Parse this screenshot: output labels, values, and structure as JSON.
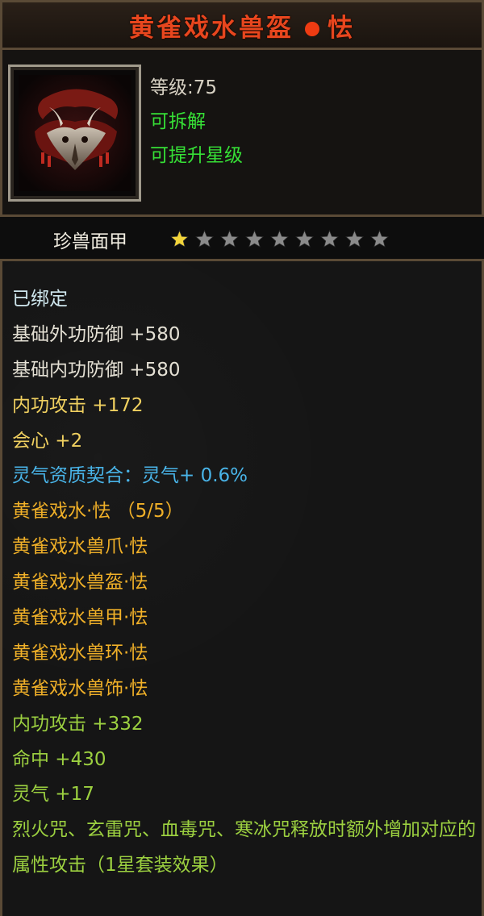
{
  "title": {
    "name_left": "黄雀戏水兽盔",
    "name_right": "怯"
  },
  "header": {
    "level": "等级:75",
    "dismantle": "可拆解",
    "upgrade_star": "可提升星级"
  },
  "item": {
    "type_name": "珍兽面甲",
    "stars_filled": 1,
    "stars_total": 9
  },
  "attributes": {
    "bound": "已绑定",
    "base_outer_defense": "基础外功防御 +580",
    "base_inner_defense": "基础内功防御 +580",
    "inner_attack": "内功攻击 +172",
    "critical": "会心 +2",
    "spirit_bonus": "灵气资质契合：灵气+ 0.6%",
    "set_name": "黄雀戏水·怯 （5/5）",
    "set_pieces": [
      "黄雀戏水兽爪·怯",
      "黄雀戏水兽盔·怯",
      "黄雀戏水兽甲·怯",
      "黄雀戏水兽环·怯",
      "黄雀戏水兽饰·怯"
    ],
    "set_inner_attack": "内功攻击 +332",
    "set_hit": "命中 +430",
    "set_spirit": "灵气 +17",
    "set_effect": "烈火咒、玄雷咒、血毒咒、寒冰咒释放时额外增加对应的属性攻击（1星套装效果）"
  },
  "colors": {
    "title": "#e8461e",
    "green": "#36e036",
    "set_orange": "#f0b028",
    "set_green": "#9cd040",
    "spirit_blue": "#49b4e8",
    "star_gold": "#f2d43a",
    "star_empty": "#8a8a8a"
  }
}
